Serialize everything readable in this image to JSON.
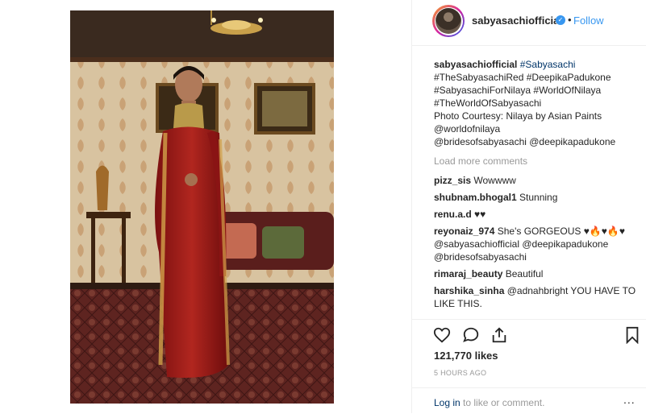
{
  "post": {
    "username": "sabyasachiofficial",
    "follow_label": "Follow",
    "separator": "•",
    "caption": {
      "username": "sabyasachiofficial",
      "lines": [
        "#Sabyasachi",
        "#TheSabyasachiRed #DeepikaPadukone",
        "#SabyasachiForNilaya #WorldOfNilaya",
        "#TheWorldOfSabyasachi",
        "Photo Courtesy: Nilaya by Asian Paints",
        "@worldofnilaya",
        "@brides​ofsabyasachi @deepikapadukone"
      ]
    },
    "load_more": "Load more comments",
    "comments": [
      {
        "user": "pizz_sis",
        "text": "Wowwww"
      },
      {
        "user": "shubnam.bhogal1",
        "text": "Stunning"
      },
      {
        "user": "renu.a.d",
        "text": "♥♥"
      },
      {
        "user": "reyonaiz_974",
        "text": "She's GORGEOUS ♥🔥♥🔥♥ @sabyasachiofficial @deepikapadukone @bridesofsabyasachi"
      },
      {
        "user": "rimaraj_beauty",
        "text": "Beautiful"
      },
      {
        "user": "harshika_sinha",
        "text": "@adnahbright YOU HAVE TO LIKE THIS."
      }
    ],
    "likes": "121,770 likes",
    "time_ago": "5 HOURS AGO",
    "login": {
      "link": "Log in",
      "rest": " to like or comment."
    },
    "more_label": "..."
  },
  "icons": {
    "like": "heart-icon",
    "comment": "comment-bubble-icon",
    "share": "share-icon",
    "save": "bookmark-icon",
    "verified": "verified-badge-icon"
  },
  "colors": {
    "link_blue": "#3897f0",
    "hashtag": "#003569",
    "muted": "#999999",
    "saree_red": "#9e1b1b"
  }
}
